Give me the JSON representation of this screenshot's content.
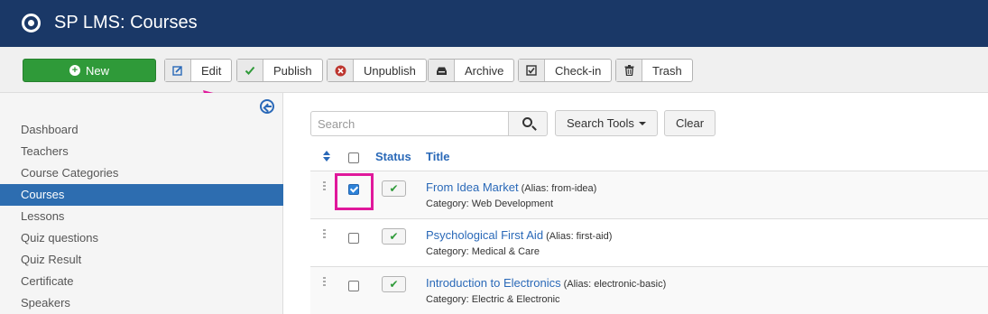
{
  "header": {
    "title": "SP LMS: Courses",
    "icon": "joomla-logo-icon"
  },
  "toolbar": {
    "buttons": [
      {
        "label": "New",
        "icon": "plus-circle-icon"
      },
      {
        "label": "Edit",
        "icon": "edit-icon"
      },
      {
        "label": "Publish",
        "icon": "check-icon"
      },
      {
        "label": "Unpublish",
        "icon": "remove-icon"
      },
      {
        "label": "Archive",
        "icon": "archive-icon"
      },
      {
        "label": "Check-in",
        "icon": "checkin-icon"
      },
      {
        "label": "Trash",
        "icon": "trash-icon"
      }
    ]
  },
  "sidebar": {
    "items": [
      {
        "label": "Dashboard",
        "active": false
      },
      {
        "label": "Teachers",
        "active": false
      },
      {
        "label": "Course Categories",
        "active": false
      },
      {
        "label": "Courses",
        "active": true
      },
      {
        "label": "Lessons",
        "active": false
      },
      {
        "label": "Quiz questions",
        "active": false
      },
      {
        "label": "Quiz Result",
        "active": false
      },
      {
        "label": "Certificate",
        "active": false
      },
      {
        "label": "Speakers",
        "active": false
      }
    ]
  },
  "filters": {
    "search_placeholder": "Search",
    "search_tools_label": "Search Tools",
    "clear_label": "Clear"
  },
  "table": {
    "headers": {
      "status": "Status",
      "title": "Title"
    },
    "rows": [
      {
        "title": "From Idea Market",
        "alias": "(Alias: from-idea)",
        "category": "Category: Web Development",
        "checked": true,
        "published": true
      },
      {
        "title": "Psychological First Aid",
        "alias": "(Alias: first-aid)",
        "category": "Category: Medical & Care",
        "checked": false,
        "published": true
      },
      {
        "title": "Introduction to Electronics",
        "alias": "(Alias: electronic-basic)",
        "category": "Category: Electric & Electronic",
        "checked": false,
        "published": true
      }
    ]
  },
  "colors": {
    "header_bg": "#1a3867",
    "accent": "#2a69b8",
    "new_button": "#2f9a39",
    "highlight": "#e0189b"
  }
}
